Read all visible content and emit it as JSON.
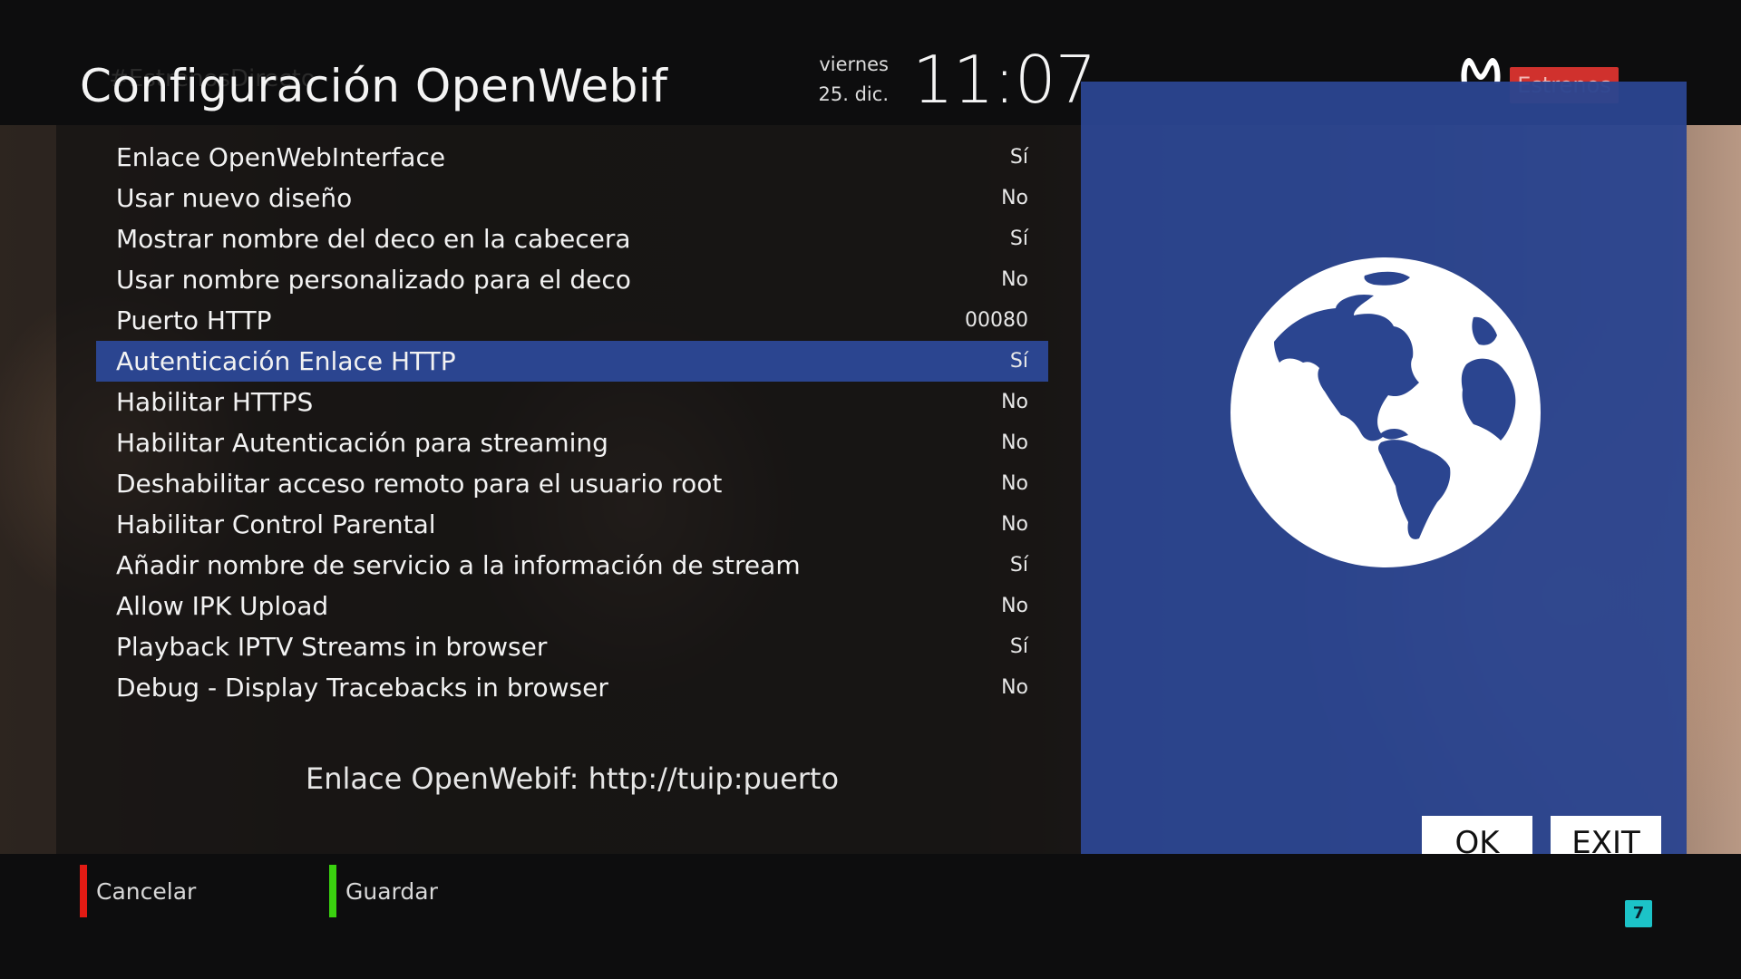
{
  "header": {
    "ghost_title": "#EstrenosDirecto",
    "title": "Configuración OpenWebif",
    "date_day": "viernes",
    "date_date": "25. dic.",
    "time": "11:07",
    "channel_tag": "Estrenos",
    "brand_icon": "movistar-m-logo"
  },
  "settings": [
    {
      "label": "Enlace OpenWebInterface",
      "value": "Sí",
      "selected": false
    },
    {
      "label": "Usar nuevo diseño",
      "value": "No",
      "selected": false
    },
    {
      "label": "Mostrar nombre del deco en la cabecera",
      "value": "Sí",
      "selected": false
    },
    {
      "label": "Usar nombre personalizado para el deco",
      "value": "No",
      "selected": false
    },
    {
      "label": "Puerto HTTP",
      "value": "00080",
      "selected": false
    },
    {
      "label": "Autenticación Enlace HTTP",
      "value": "Sí",
      "selected": true
    },
    {
      "label": "Habilitar HTTPS",
      "value": "No",
      "selected": false
    },
    {
      "label": "Habilitar Autenticación para streaming",
      "value": "No",
      "selected": false
    },
    {
      "label": "Deshabilitar acceso remoto para el usuario root",
      "value": "No",
      "selected": false
    },
    {
      "label": "Habilitar Control Parental",
      "value": "No",
      "selected": false
    },
    {
      "label": "Añadir nombre de servicio a la información de stream",
      "value": "Sí",
      "selected": false
    },
    {
      "label": "Allow IPK Upload",
      "value": "No",
      "selected": false
    },
    {
      "label": "Playback IPTV Streams in browser",
      "value": "Sí",
      "selected": false
    },
    {
      "label": "Debug - Display Tracebacks in browser",
      "value": "No",
      "selected": false
    }
  ],
  "hint": "Enlace OpenWebif: http://tuip:puerto",
  "info_pane": {
    "icon": "globe-icon",
    "ok_label": "OK",
    "exit_label": "EXIT"
  },
  "footer": {
    "red_label": "Cancelar",
    "green_label": "Guardar",
    "badge": "7"
  },
  "colors": {
    "selection": "#2b4590",
    "key_red": "#e21b14",
    "key_green": "#3ad10f",
    "badge": "#1cc3c8"
  }
}
